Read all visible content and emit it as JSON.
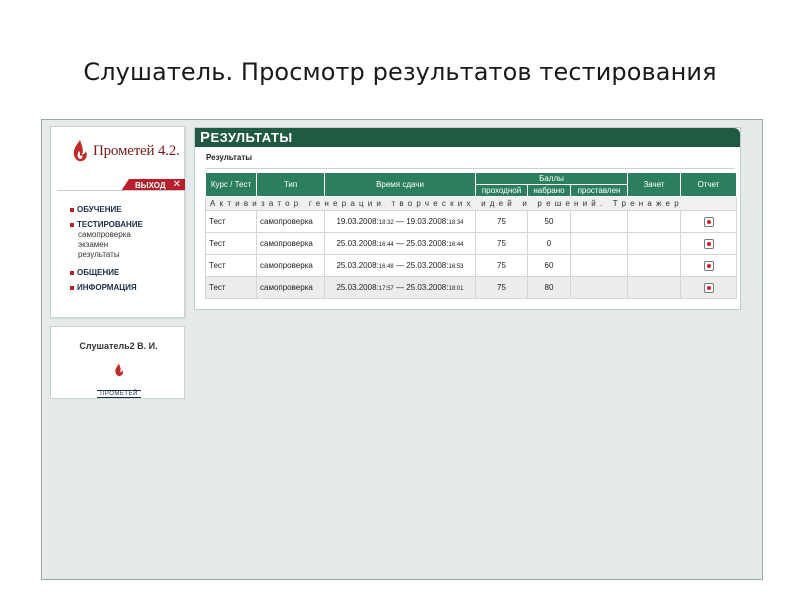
{
  "slide": {
    "title": "Слушатель. Просмотр результатов тестирования"
  },
  "sidebar": {
    "logo_text": "Прометей 4.2.",
    "exit_label": "ВЫХОД",
    "exit_icon": "close-icon",
    "menu": {
      "training": "ОБУЧЕНИЕ",
      "testing": "ТЕСТИРОВАНИЕ",
      "testing_sub": [
        "самопроверка",
        "экзамен",
        "результаты"
      ],
      "communication": "ОБЩЕНИЕ",
      "information": "ИНФОРМАЦИЯ"
    },
    "user_name": "Слушатель2 В. И.",
    "small_logo_text": "ПРОМЕТЕЙ"
  },
  "panel": {
    "header_cap": "Р",
    "header_rest": "ЕЗУЛЬТАТЫ",
    "subtitle": "Результаты",
    "columns": {
      "course": "Курс / Тест",
      "type": "Тип",
      "time": "Время сдачи",
      "scores": "Баллы",
      "passing": "проходной",
      "earned": "набрано",
      "assigned": "проставлен",
      "credit": "Зачет",
      "report": "Отчет"
    },
    "group_name": "Активизатор генерации творческих идей и решений. Тренажер",
    "rows": [
      {
        "test": "Тест",
        "type": "самопроверка",
        "d1": "19.03.2008:",
        "t1": "18:32",
        "sep": " — ",
        "d2": "19.03.2008:",
        "t2": "18:34",
        "passing": "75",
        "earned": "50",
        "assigned": "",
        "credit": ""
      },
      {
        "test": "Тест",
        "type": "самопроверка",
        "d1": "25.03.2008:",
        "t1": "16:44",
        "sep": " — ",
        "d2": "25.03.2008:",
        "t2": "16:44",
        "passing": "75",
        "earned": "0",
        "assigned": "",
        "credit": ""
      },
      {
        "test": "Тест",
        "type": "самопроверка",
        "d1": "25.03.2008:",
        "t1": "16:48",
        "sep": " — ",
        "d2": "25.03.2008:",
        "t2": "16:53",
        "passing": "75",
        "earned": "60",
        "assigned": "",
        "credit": ""
      },
      {
        "test": "Тест",
        "type": "самопроверка",
        "d1": "25.03.2008:",
        "t1": "17:57",
        "sep": " — ",
        "d2": "25.03.2008:",
        "t2": "18:01",
        "passing": "75",
        "earned": "80",
        "assigned": "",
        "credit": ""
      }
    ]
  },
  "colors": {
    "header_green": "#1f5b43",
    "table_green": "#2b7f5f",
    "accent_red": "#b81f2a"
  }
}
